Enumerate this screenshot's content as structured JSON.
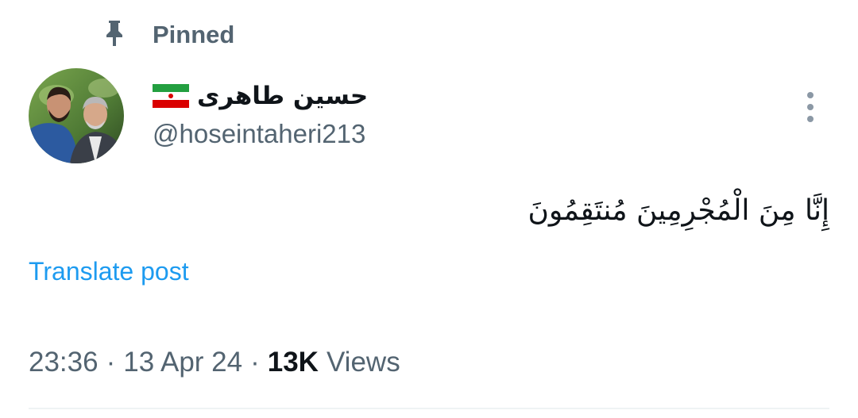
{
  "pinned": {
    "label": "Pinned",
    "icon": "pin-icon"
  },
  "author": {
    "display_name": "حسین طاهری",
    "flag_icon": "iran-flag-icon",
    "handle": "@hoseintaheri213"
  },
  "post": {
    "text": "إِنَّا مِنَ الْمُجْرِمِينَ مُنتَقِمُونَ",
    "translate_label": "Translate post",
    "time": "23:36",
    "date": "13 Apr 24",
    "separator": "·",
    "views_count": "13K",
    "views_label": "Views"
  },
  "colors": {
    "text_primary": "#0f1419",
    "text_secondary": "#536471",
    "link": "#1d9bf0",
    "divider": "#eff3f4"
  },
  "menu": {
    "icon": "more-vertical-icon"
  }
}
